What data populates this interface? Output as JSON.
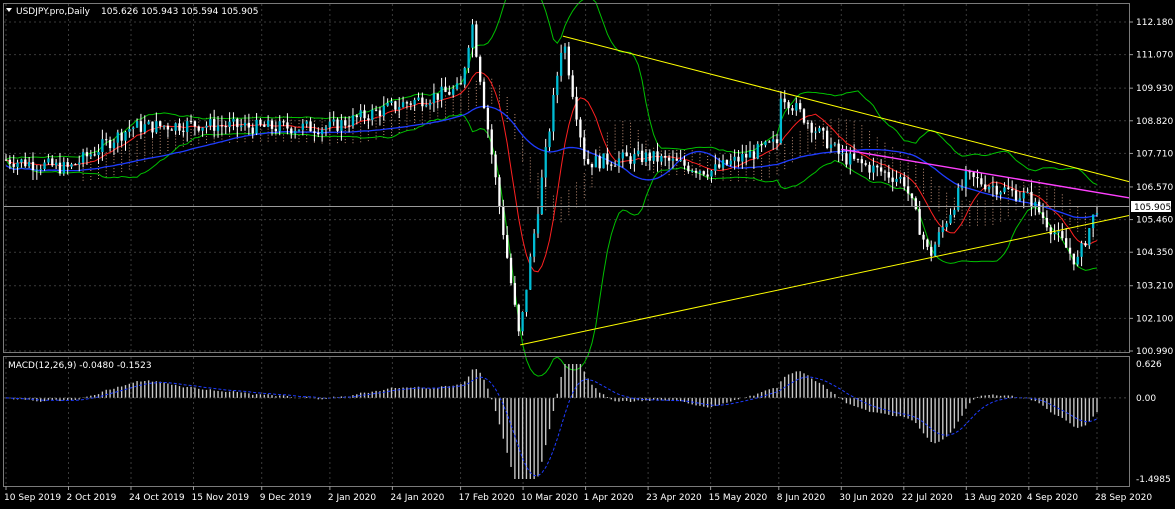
{
  "colors": {
    "background": "#000000",
    "grid": "#3a3a3a",
    "axis_text": "#ffffff",
    "bull_candle": "#00bcd4",
    "bear_candle": "#ffffff",
    "wick": "#ffffff",
    "price_line": "#ffffff",
    "trend_line": "#ffff00",
    "bollinger": "#00c000",
    "ma_red": "#ff2020",
    "ma_blue": "#1e3cff",
    "magenta_line": "#ff40ff",
    "ichimoku_cloud": "#ffc0a0",
    "macd_hist": "#c8c8c8",
    "macd_signal": "#1e3cff"
  },
  "header": {
    "dropdown_icon": "triangle-down-icon",
    "symbol_label": "USDJPY.pro,Daily",
    "ohlc": "105.626 105.943 105.594 105.905"
  },
  "macd": {
    "label": "MACD(12,26,9) -0.0480 -0.1523",
    "value": -0.048,
    "signal": -0.1523,
    "axis_ticks": [
      "0.626",
      "0.00",
      "-1.4985"
    ],
    "ylim": [
      -1.4985,
      0.626
    ]
  },
  "chart_data": {
    "type": "line",
    "series_style": "candlestick",
    "ylim": [
      100.99,
      112.18
    ],
    "y_ticks": [
      "112.180",
      "111.070",
      "109.930",
      "108.820",
      "107.710",
      "106.570",
      "105.460",
      "104.350",
      "103.210",
      "102.100",
      "100.990"
    ],
    "y_tick_values": [
      112.18,
      111.07,
      109.93,
      108.82,
      107.71,
      106.57,
      105.46,
      104.35,
      103.21,
      102.1,
      100.99
    ],
    "current_price_label": "105.905",
    "current_price": 105.905,
    "x_ticks": [
      "10 Sep 2019",
      "2 Oct 2019",
      "24 Oct 2019",
      "15 Nov 2019",
      "9 Dec 2019",
      "2 Jan 2020",
      "24 Jan 2020",
      "17 Feb 2020",
      "10 Mar 2020",
      "1 Apr 2020",
      "23 Apr 2020",
      "15 May 2020",
      "8 Jun 2020",
      "30 Jun 2020",
      "22 Jul 2020",
      "13 Aug 2020",
      "4 Sep 2020",
      "28 Sep 2020"
    ],
    "close_path": [
      [
        "10 Sep 2019",
        107.5
      ],
      [
        "2 Oct 2019",
        107.2
      ],
      [
        "24 Oct 2019",
        108.6
      ],
      [
        "15 Nov 2019",
        108.7
      ],
      [
        "9 Dec 2019",
        108.6
      ],
      [
        "2 Jan 2020",
        108.6
      ],
      [
        "24 Jan 2020",
        109.3
      ],
      [
        "17 Feb 2020",
        109.9
      ],
      [
        "10 Mar 2020",
        102.4
      ],
      [
        "1 Apr 2020",
        107.4
      ],
      [
        "23 Apr 2020",
        107.6
      ],
      [
        "15 May 2020",
        107.1
      ],
      [
        "8 Jun 2020",
        108.1
      ],
      [
        "30 Jun 2020",
        107.6
      ],
      [
        "22 Jul 2020",
        106.8
      ],
      [
        "13 Aug 2020",
        106.9
      ],
      [
        "4 Sep 2020",
        106.2
      ],
      [
        "28 Sep 2020",
        105.9
      ]
    ],
    "highs": [
      [
        "21 Feb 2020",
        112.2
      ],
      [
        "24 Mar 2020",
        111.7
      ],
      [
        "8 Jun 2020",
        109.85
      ]
    ],
    "lows": [
      [
        "9 Mar 2020",
        101.2
      ],
      [
        "31 Jul 2020",
        104.2
      ],
      [
        "21 Sep 2020",
        104.0
      ]
    ]
  }
}
